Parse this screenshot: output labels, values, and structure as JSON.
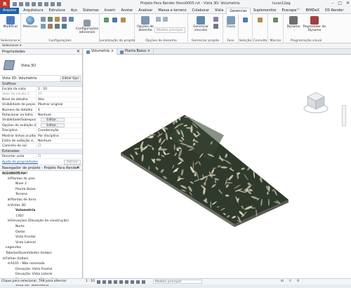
{
  "title_bar": {
    "logo": "R",
    "document_title": "Projeto Para Render Novo0005.rvt - Vista 3D: Volumetria",
    "user": "lucas12pg"
  },
  "ribbon_tabs": [
    "Arquivo",
    "Arquitetura",
    "Estrutura",
    "Aço",
    "Sistemas",
    "Inserir",
    "Anotar",
    "Analisar",
    "Massa e terreno",
    "Colaborar",
    "Vista",
    "Gerenciar",
    "Suplementos",
    "Enscape™",
    "BIMDeX",
    "DS Render"
  ],
  "active_tab": "Gerenciar",
  "ribbon": {
    "modify": "Modificar",
    "materials": "Materiais",
    "select_label": "Selecionar ▾",
    "additional_settings": "Configurações adicionais",
    "configurations_label": "Configurações",
    "project_location_label": "Localização do projeto",
    "design_options": "Opções de desenho",
    "main_model": "Modelo principal",
    "design_options_label": "Opções de desenho",
    "manage_links": "Gerenciar vínculos",
    "manage_project_label": "Gerenciar projeto",
    "phases": "Fases",
    "phase_label": "Fase",
    "selection_label": "Seleção",
    "inquiry_label": "Consulta",
    "macros_label": "Macros",
    "dynamo": "Dynamo",
    "dynamo_player": "Reprodutor do Dynamo",
    "visual_programming_label": "Programação visual"
  },
  "selector": "Selecionar ▾",
  "properties": {
    "header": "Propriedades",
    "type_name": "Vista 3D",
    "view_selector": "Vista 3D: Volumetria",
    "edit_type": "Editar tipo",
    "group_graphics": "Gráficos",
    "rows": [
      {
        "k": "Escala da vista",
        "v": "1 : 10"
      },
      {
        "k": "Valor de escala  1:",
        "v": "10",
        "dim": true
      },
      {
        "k": "Nível de detalhe",
        "v": "Alto"
      },
      {
        "k": "Visibilidade de peças",
        "v": "Mostrar original"
      },
      {
        "k": "Número de detalhe",
        "v": "4"
      },
      {
        "k": "Rotacionar na folha",
        "v": "Nenhum"
      },
      {
        "k": "Visibilidade/Sobrepos...",
        "v": "Editar...",
        "btn": true
      },
      {
        "k": "Opções de exibição d...",
        "v": "Editar...",
        "btn": true
      },
      {
        "k": "Disciplina",
        "v": "Coordenação"
      },
      {
        "k": "Mostrar linhas ocultas",
        "v": "Por disciplina"
      },
      {
        "k": "Estilo de exibição d...",
        "v": "Nenhum"
      },
      {
        "k": "Caminho do sol",
        "v": "☐"
      }
    ],
    "group_extents": "Extensões",
    "extent_rows": [
      {
        "k": "Recortar vista",
        "v": "☐"
      }
    ],
    "help_link": "Ajuda de propriedades",
    "apply": "Aplicar"
  },
  "project_browser": {
    "header": "Navegador de projeto - Projeto Para Render Novo0005.rvt",
    "items": [
      {
        "indent": 0,
        "toggle": "⊟",
        "label": "Vistas (todas)"
      },
      {
        "indent": 1,
        "toggle": "⊟",
        "label": "Plantas de piso"
      },
      {
        "indent": 2,
        "toggle": "",
        "label": "Nível 2"
      },
      {
        "indent": 2,
        "toggle": "",
        "label": "Planta Baixa"
      },
      {
        "indent": 2,
        "toggle": "",
        "label": "Terreno"
      },
      {
        "indent": 1,
        "toggle": "⊞",
        "label": "Plantas de forro"
      },
      {
        "indent": 1,
        "toggle": "⊟",
        "label": "Vistas 3D"
      },
      {
        "indent": 2,
        "toggle": "",
        "label": "Volumetria",
        "bold": true
      },
      {
        "indent": 2,
        "toggle": "",
        "label": "{3D}"
      },
      {
        "indent": 1,
        "toggle": "⊟",
        "label": "Elevações (Elevação da construção)"
      },
      {
        "indent": 2,
        "toggle": "",
        "label": "Norte"
      },
      {
        "indent": 2,
        "toggle": "",
        "label": "Oeste"
      },
      {
        "indent": 2,
        "toggle": "",
        "label": "Vista Frontal"
      },
      {
        "indent": 2,
        "toggle": "",
        "label": "Vista Lateral"
      },
      {
        "indent": 0,
        "toggle": "",
        "label": "Legendas"
      },
      {
        "indent": 0,
        "toggle": "",
        "label": "Tabelas/Quantidades (todas)"
      },
      {
        "indent": 0,
        "toggle": "⊟",
        "label": "Folhas (todas)"
      },
      {
        "indent": 1,
        "toggle": "⊟",
        "label": "A101 - Não nomeada"
      },
      {
        "indent": 2,
        "toggle": "",
        "label": "Elevação: Vista Frontal"
      },
      {
        "indent": 2,
        "toggle": "",
        "label": "Elevação: Vista Lateral"
      },
      {
        "indent": 2,
        "toggle": "",
        "label": "Planta de piso: Planta Baixa"
      },
      {
        "indent": 2,
        "toggle": "",
        "label": "Vista 3D: Volumetria"
      }
    ]
  },
  "view_tabs": [
    {
      "label": "Volumetria",
      "active": true
    },
    {
      "label": "Planta Baixa",
      "active": false
    }
  ],
  "viewcube": {
    "top": "TOPO",
    "front": "FRENTE"
  },
  "view_control": {
    "scale": "1 : 10"
  },
  "status": {
    "text": "Clique para selecionar, TAB para alternar",
    "model": "Modelo principal",
    "counter": "0"
  }
}
